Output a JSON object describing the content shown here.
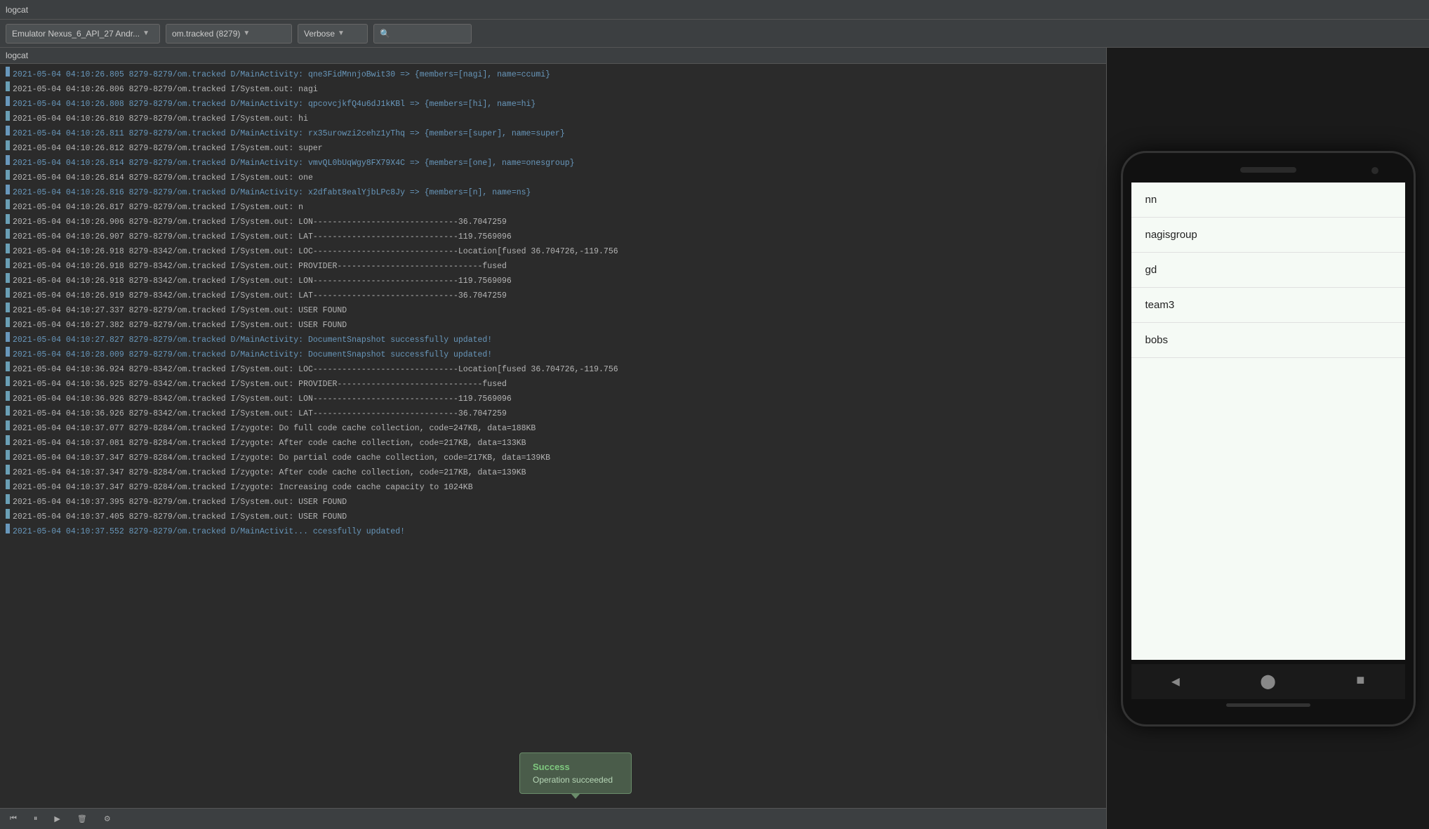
{
  "titleBar": {
    "text": "logcat"
  },
  "toolbar": {
    "deviceLabel": "Emulator Nexus_6_API_27 Andr...",
    "processLabel": "om.tracked (8279)",
    "levelLabel": "Verbose",
    "searchPlaceholder": "🔍"
  },
  "logcat": {
    "title": "logcat",
    "lines": [
      {
        "level": "D",
        "text": "2021-05-04 04:10:26.805 8279-8279/om.tracked D/MainActivity: qne3FidMnnjoBwit30 => {members=[nagi], name=ccumi}"
      },
      {
        "level": "I",
        "text": "2021-05-04 04:10:26.806 8279-8279/om.tracked I/System.out: nagi"
      },
      {
        "level": "D",
        "text": "2021-05-04 04:10:26.808 8279-8279/om.tracked D/MainActivity: qpcovcjkfQ4u6dJ1kKBl => {members=[hi], name=hi}"
      },
      {
        "level": "I",
        "text": "2021-05-04 04:10:26.810 8279-8279/om.tracked I/System.out: hi"
      },
      {
        "level": "D",
        "text": "2021-05-04 04:10:26.811 8279-8279/om.tracked D/MainActivity: rx35urowzi2cehz1yThq => {members=[super], name=super}"
      },
      {
        "level": "I",
        "text": "2021-05-04 04:10:26.812 8279-8279/om.tracked I/System.out: super"
      },
      {
        "level": "D",
        "text": "2021-05-04 04:10:26.814 8279-8279/om.tracked D/MainActivity: vmvQL0bUqWgy8FX79X4C => {members=[one], name=onesgroup}"
      },
      {
        "level": "I",
        "text": "2021-05-04 04:10:26.814 8279-8279/om.tracked I/System.out: one"
      },
      {
        "level": "D",
        "text": "2021-05-04 04:10:26.816 8279-8279/om.tracked D/MainActivity: x2dfabt8ealYjbLPc8Jy => {members=[n], name=ns}"
      },
      {
        "level": "I",
        "text": "2021-05-04 04:10:26.817 8279-8279/om.tracked I/System.out: n"
      },
      {
        "level": "I",
        "text": "2021-05-04 04:10:26.906 8279-8279/om.tracked I/System.out: LON------------------------------36.7047259"
      },
      {
        "level": "I",
        "text": "2021-05-04 04:10:26.907 8279-8279/om.tracked I/System.out: LAT------------------------------119.7569096"
      },
      {
        "level": "I",
        "text": "2021-05-04 04:10:26.918 8279-8342/om.tracked I/System.out: LOC------------------------------Location[fused 36.704726,-119.756"
      },
      {
        "level": "I",
        "text": "2021-05-04 04:10:26.918 8279-8342/om.tracked I/System.out: PROVIDER------------------------------fused"
      },
      {
        "level": "I",
        "text": "2021-05-04 04:10:26.918 8279-8342/om.tracked I/System.out: LON------------------------------119.7569096"
      },
      {
        "level": "I",
        "text": "2021-05-04 04:10:26.919 8279-8342/om.tracked I/System.out: LAT------------------------------36.7047259"
      },
      {
        "level": "I",
        "text": "2021-05-04 04:10:27.337 8279-8279/om.tracked I/System.out: USER FOUND"
      },
      {
        "level": "I",
        "text": "2021-05-04 04:10:27.382 8279-8279/om.tracked I/System.out: USER FOUND"
      },
      {
        "level": "D",
        "text": "2021-05-04 04:10:27.827 8279-8279/om.tracked D/MainActivity: DocumentSnapshot successfully updated!"
      },
      {
        "level": "D",
        "text": "2021-05-04 04:10:28.009 8279-8279/om.tracked D/MainActivity: DocumentSnapshot successfully updated!"
      },
      {
        "level": "I",
        "text": "2021-05-04 04:10:36.924 8279-8342/om.tracked I/System.out: LOC------------------------------Location[fused 36.704726,-119.756"
      },
      {
        "level": "I",
        "text": "2021-05-04 04:10:36.925 8279-8342/om.tracked I/System.out: PROVIDER------------------------------fused"
      },
      {
        "level": "I",
        "text": "2021-05-04 04:10:36.926 8279-8342/om.tracked I/System.out: LON------------------------------119.7569096"
      },
      {
        "level": "I",
        "text": "2021-05-04 04:10:36.926 8279-8342/om.tracked I/System.out: LAT------------------------------36.7047259"
      },
      {
        "level": "I",
        "text": "2021-05-04 04:10:37.077 8279-8284/om.tracked I/zygote: Do full code cache collection, code=247KB, data=188KB"
      },
      {
        "level": "I",
        "text": "2021-05-04 04:10:37.081 8279-8284/om.tracked I/zygote: After code cache collection, code=217KB, data=133KB"
      },
      {
        "level": "I",
        "text": "2021-05-04 04:10:37.347 8279-8284/om.tracked I/zygote: Do partial code cache collection, code=217KB, data=139KB"
      },
      {
        "level": "I",
        "text": "2021-05-04 04:10:37.347 8279-8284/om.tracked I/zygote: After code cache collection, code=217KB, data=139KB"
      },
      {
        "level": "I",
        "text": "2021-05-04 04:10:37.347 8279-8284/om.tracked I/zygote: Increasing code cache capacity to 1024KB"
      },
      {
        "level": "I",
        "text": "2021-05-04 04:10:37.395 8279-8279/om.tracked I/System.out: USER FOUND"
      },
      {
        "level": "I",
        "text": "2021-05-04 04:10:37.405 8279-8279/om.tracked I/System.out: USER FOUND"
      },
      {
        "level": "D",
        "text": "2021-05-04 04:10:37.552 8279-8279/om.tracked D/MainActivit... ccessfully updated!"
      }
    ]
  },
  "toast": {
    "title": "Success",
    "message": "Operation succeeded"
  },
  "bottomBar": {
    "buttons": [
      "⏮",
      "⏸",
      "▶",
      "🗑",
      "⚙"
    ]
  },
  "phone": {
    "listItems": [
      "nn",
      "nagisgroup",
      "gd",
      "team3",
      "bobs"
    ]
  }
}
